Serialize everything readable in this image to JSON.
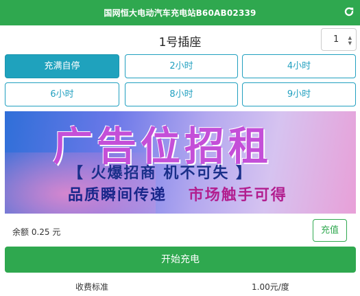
{
  "header": {
    "title": "国网恒大电动汽车充电站B60AB02339",
    "refresh_icon": "refresh-icon",
    "color": "#2fa84f"
  },
  "socket": {
    "title": "1号插座",
    "selected": "1"
  },
  "options": [
    {
      "label": "充满自停",
      "active": true
    },
    {
      "label": "2小时",
      "active": false
    },
    {
      "label": "4小时",
      "active": false
    },
    {
      "label": "6小时",
      "active": false
    },
    {
      "label": "8小时",
      "active": false
    },
    {
      "label": "9小时",
      "active": false
    }
  ],
  "banner": {
    "line1": "广告位招租",
    "line2": "【 火爆招商  机不可失 】",
    "line3a": "品质瞬间传递",
    "line3b": "市场触手可得"
  },
  "balance": {
    "label": "余额 0.25 元",
    "recharge_label": "充值"
  },
  "start_label": "开始充电",
  "fee": {
    "label": "收费标准",
    "value": "1.00元/度"
  },
  "accent": "#1fa2bd"
}
